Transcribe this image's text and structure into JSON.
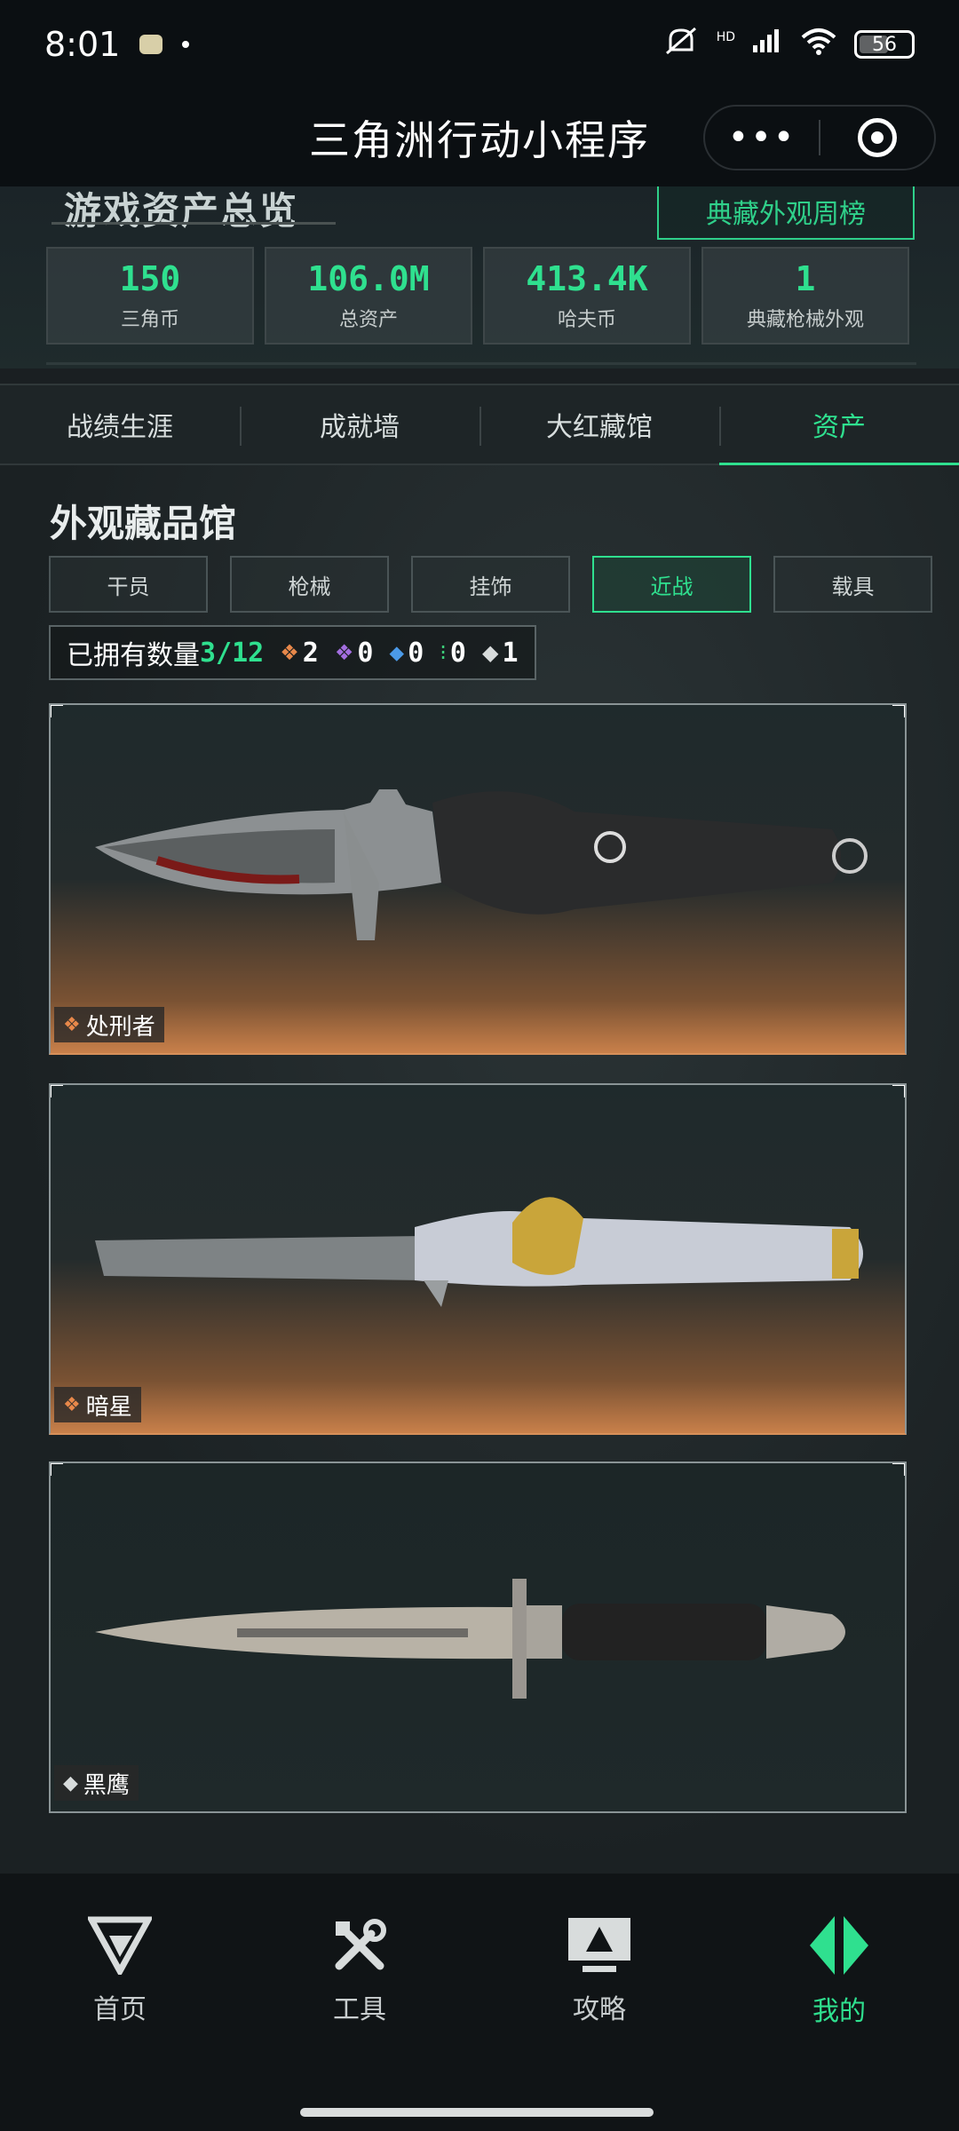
{
  "status_bar": {
    "time": "8:01",
    "network": "HD",
    "battery": "56"
  },
  "title_bar": {
    "title": "三角洲行动小程序",
    "more": "•••"
  },
  "overview": {
    "title": "游戏资产总览",
    "weekly_button": "典藏外观周榜",
    "stats": [
      {
        "value": "150",
        "label": "三角币"
      },
      {
        "value": "106.0M",
        "label": "总资产"
      },
      {
        "value": "413.4K",
        "label": "哈夫币"
      },
      {
        "value": "1",
        "label": "典藏枪械外观"
      }
    ]
  },
  "tabs": [
    {
      "label": "战绩生涯",
      "active": false
    },
    {
      "label": "成就墙",
      "active": false
    },
    {
      "label": "大红藏馆",
      "active": false
    },
    {
      "label": "资产",
      "active": true
    }
  ],
  "collection": {
    "title": "外观藏品馆",
    "categories": [
      {
        "label": "干员",
        "active": false
      },
      {
        "label": "枪械",
        "active": false
      },
      {
        "label": "挂饰",
        "active": false
      },
      {
        "label": "近战",
        "active": true
      },
      {
        "label": "载具",
        "active": false
      }
    ],
    "owned_label": "已拥有数量",
    "owned_count": "3/12",
    "rarity_counts": [
      {
        "icon": "orange-diamond-icon",
        "color": "#e8884a",
        "count": "2"
      },
      {
        "icon": "purple-diamond-icon",
        "color": "#a36ee0",
        "count": "0"
      },
      {
        "icon": "blue-diamond-icon",
        "color": "#4b9ae8",
        "count": "0"
      },
      {
        "icon": "green-diamond-icon",
        "color": "#3ccf7a",
        "count": "0"
      },
      {
        "icon": "white-diamond-icon",
        "color": "#d8dcdc",
        "count": "1"
      }
    ],
    "items": [
      {
        "name": "处刑者",
        "rarity_color": "#e8884a",
        "style": "orange"
      },
      {
        "name": "暗星",
        "rarity_color": "#e8884a",
        "style": "orange"
      },
      {
        "name": "黑鹰",
        "rarity_color": "#d8dcdc",
        "style": "dark"
      }
    ]
  },
  "bottom_nav": [
    {
      "label": "首页",
      "icon": "home-logo-icon",
      "active": false
    },
    {
      "label": "工具",
      "icon": "tools-icon",
      "active": false
    },
    {
      "label": "攻略",
      "icon": "guide-monitor-icon",
      "active": false
    },
    {
      "label": "我的",
      "icon": "profile-emblem-icon",
      "active": true
    }
  ],
  "colors": {
    "accent": "#2fe08f",
    "background": "#1a1f22"
  }
}
